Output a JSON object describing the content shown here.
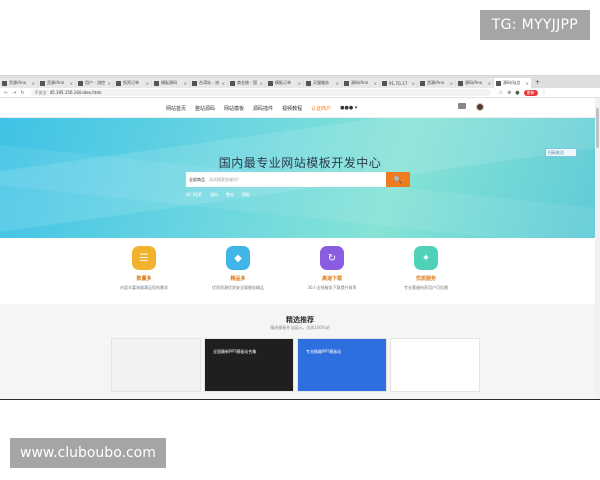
{
  "watermark": {
    "top": "TG: MYYJJPP",
    "bottom": "www.cluboubo.com"
  },
  "browser": {
    "tabs": [
      {
        "label": "货源/Ano"
      },
      {
        "label": "货源/Ano"
      },
      {
        "label": "用户 - 流控"
      },
      {
        "label": "投资订单"
      },
      {
        "label": "模板源码"
      },
      {
        "label": "台湾站 - 流"
      },
      {
        "label": "商业统 - 国"
      },
      {
        "label": "模板订单"
      },
      {
        "label": "天猫服务"
      },
      {
        "label": "源码/Ano"
      },
      {
        "label": "91.7G.17"
      },
      {
        "label": "货源/Ano"
      },
      {
        "label": "源码/Ano"
      },
      {
        "label": "源码/站点"
      }
    ],
    "add_tab": "+",
    "address": {
      "insecure": "不安全",
      "url": "45.195.156.16/index.html"
    },
    "pill_label": "更新"
  },
  "site": {
    "nav": [
      "网站首页",
      "整站源码",
      "网站模板",
      "源码插件",
      "视频教程",
      "认证商户"
    ],
    "more": "●●● ▾",
    "hero": {
      "title": "国内最专业网站模板开发中心",
      "search_category": "全部商品",
      "search_placeholder": "试试搜索关键词？",
      "search_button": "🔍",
      "hot_words": [
        "热门搜索",
        "源码",
        "整站",
        "模板"
      ]
    },
    "qr_label": "扫码关注",
    "features": [
      {
        "title": "数量多",
        "desc": "内容丰富海量满足您的需求",
        "color": "#f2b22e",
        "icon": "☰"
      },
      {
        "title": "精品多",
        "desc": "优质资源优质安全版服务精品",
        "color": "#3fb5e8",
        "icon": "◆"
      },
      {
        "title": "高速下载",
        "desc": "30人全线服务下载提升效率",
        "color": "#8a5ce0",
        "icon": "↻"
      },
      {
        "title": "优质服务",
        "desc": "专业客服给养用户可信赖",
        "color": "#4fd1b8",
        "icon": "✦"
      }
    ],
    "recommend": {
      "title": "精选推荐",
      "subtitle": "精选模板外设展示，优质100%站",
      "thumbs": [
        {
          "label": "",
          "color": "#f2f2f2"
        },
        {
          "label": "全国最新PPT模板站合集",
          "color": "#1f1f1f"
        },
        {
          "label": "专业精美PPT模板站",
          "color": "#2e6fe0"
        },
        {
          "label": "",
          "color": "#ffffff"
        }
      ]
    }
  }
}
